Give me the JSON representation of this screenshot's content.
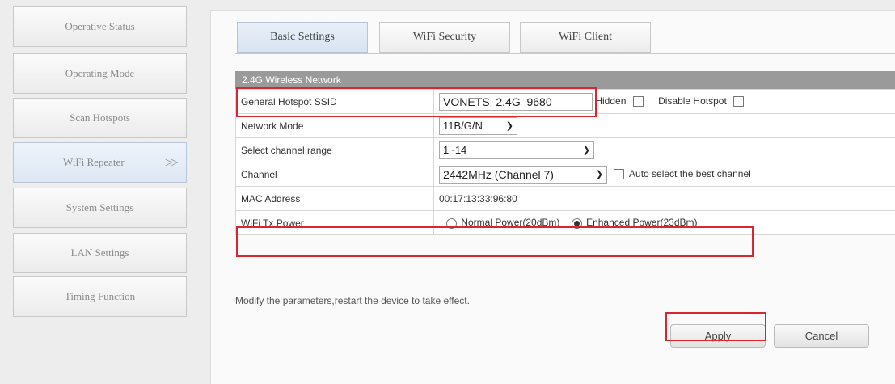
{
  "sidebar": {
    "items": [
      {
        "label": "Operative Status"
      },
      {
        "label": "Operating Mode"
      },
      {
        "label": "Scan Hotspots"
      },
      {
        "label": "WiFi Repeater",
        "chevron": ">>"
      },
      {
        "label": "System Settings"
      },
      {
        "label": "LAN Settings"
      },
      {
        "label": "Timing Function"
      }
    ]
  },
  "tabs": [
    {
      "label": "Basic Settings",
      "active": true
    },
    {
      "label": "WiFi Security"
    },
    {
      "label": "WiFi Client"
    }
  ],
  "section": {
    "title": "2.4G Wireless Network",
    "rows": {
      "ssid": {
        "label": "General Hotspot SSID",
        "value": "VONETS_2.4G_9680",
        "hidden_label": "Hidden",
        "disable_label": "Disable Hotspot"
      },
      "network_mode": {
        "label": "Network Mode",
        "value": "11B/G/N"
      },
      "channel_range": {
        "label": "Select channel range",
        "value": "1~14"
      },
      "channel": {
        "label": "Channel",
        "value": "2442MHz (Channel 7)",
        "auto_label": "Auto select the best channel"
      },
      "mac": {
        "label": "MAC Address",
        "value": "00:17:13:33:96:80"
      },
      "tx_power": {
        "label": "WiFi Tx Power",
        "normal_label": "Normal Power(20dBm)",
        "enhanced_label": "Enhanced Power(23dBm)",
        "selected": "enhanced"
      }
    }
  },
  "note": "Modify the parameters,restart the device to take effect.",
  "buttons": {
    "apply": "Apply",
    "cancel": "Cancel"
  },
  "colors": {
    "highlight": "#d9272e",
    "section_header": "#9a9a9a"
  }
}
